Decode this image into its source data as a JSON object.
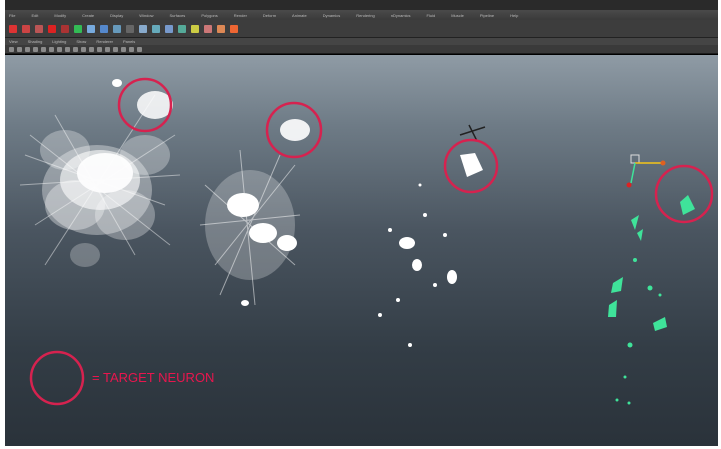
{
  "menubar": {
    "items": [
      "File",
      "Edit",
      "Modify",
      "Create",
      "Display",
      "Window",
      "Surfaces",
      "Polygons",
      "Render",
      "Deform",
      "Animate",
      "Dynamics",
      "Rendering",
      "nDynamics",
      "Fluid",
      "Muscle",
      "Pipeline",
      "Help"
    ]
  },
  "panel_menu": {
    "items": [
      "View",
      "Shading",
      "Lighting",
      "Show",
      "Renderer",
      "Panels"
    ]
  },
  "colors": {
    "target_circle": "#d6224f",
    "label_text": "#e8164e",
    "neuron_white": "#ffffff",
    "neuron_selected": "#3fe39a"
  },
  "legend": {
    "label": "= TARGET NEURON"
  }
}
